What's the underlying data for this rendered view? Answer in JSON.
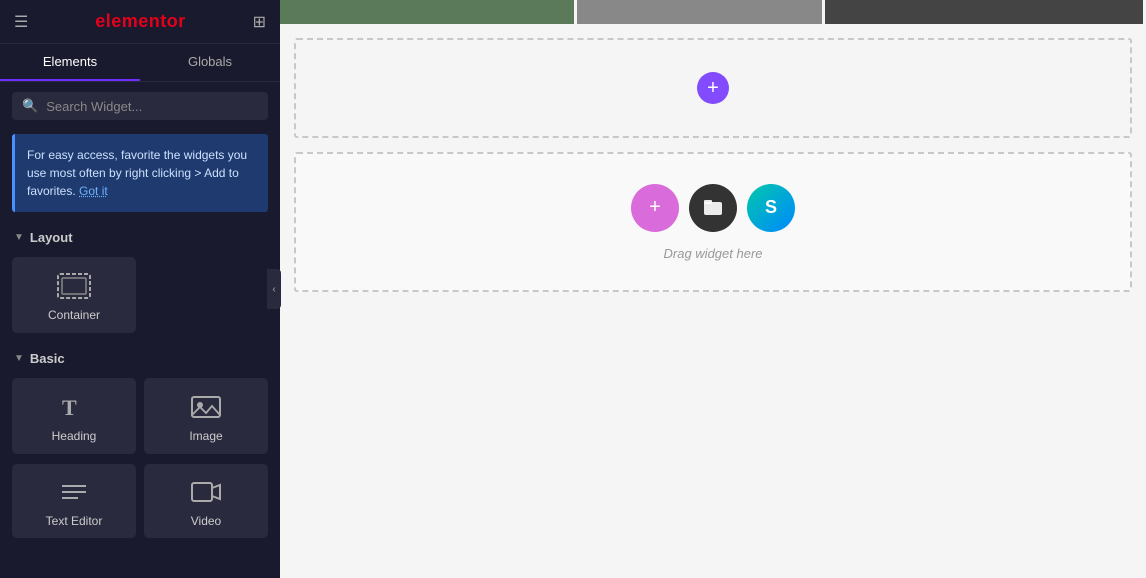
{
  "app": {
    "title": "elementor",
    "brand_color": "#e3001b",
    "accent_color": "#6e2eff"
  },
  "topbar": {
    "hamburger_label": "☰",
    "grid_label": "⊞"
  },
  "tabs": [
    {
      "id": "elements",
      "label": "Elements",
      "active": true
    },
    {
      "id": "globals",
      "label": "Globals",
      "active": false
    }
  ],
  "search": {
    "placeholder": "Search Widget..."
  },
  "info_box": {
    "text": "For easy access, favorite the widgets you use most often by right clicking > Add to favorites.",
    "link_text": "Got it"
  },
  "sections": {
    "layout": {
      "label": "Layout",
      "chevron": "▼"
    },
    "basic": {
      "label": "Basic",
      "chevron": "▼"
    }
  },
  "widgets": {
    "layout": [
      {
        "id": "container",
        "label": "Container",
        "icon": "container"
      }
    ],
    "basic": [
      {
        "id": "heading",
        "label": "Heading",
        "icon": "heading"
      },
      {
        "id": "image",
        "label": "Image",
        "icon": "image"
      },
      {
        "id": "text-editor",
        "label": "Text Editor",
        "icon": "text"
      },
      {
        "id": "video",
        "label": "Video",
        "icon": "video"
      }
    ]
  },
  "canvas": {
    "empty_section_plus": "+",
    "drag_text": "Drag widget here",
    "drag_icons": [
      {
        "id": "add",
        "symbol": "+",
        "color_class": "pink"
      },
      {
        "id": "folder",
        "symbol": "⬛",
        "color_class": "dark"
      },
      {
        "id": "elementor",
        "symbol": "S",
        "color_class": "green-blue"
      }
    ]
  },
  "collapse_handle": "‹"
}
